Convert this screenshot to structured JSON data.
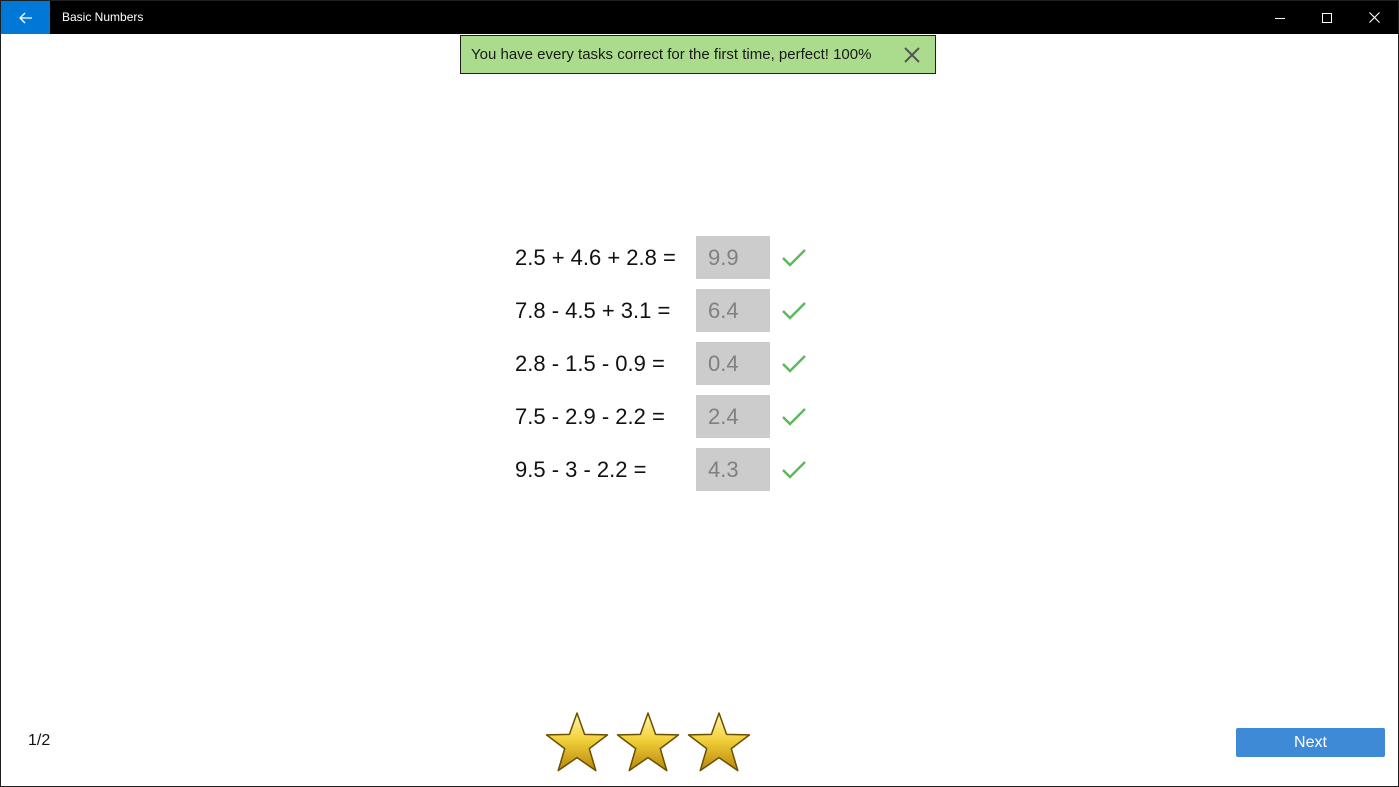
{
  "window": {
    "title": "Basic Numbers",
    "accent_color": "#0078d7",
    "icons": [
      "back-arrow-icon",
      "minimize-icon",
      "maximize-icon",
      "close-icon"
    ]
  },
  "banner": {
    "message": "You have every tasks correct for the first time, perfect! 100%",
    "background_color": "#abdc8e",
    "icon": "close-icon"
  },
  "tasks": [
    {
      "expression": "2.5 + 4.6 + 2.8 =",
      "answer": "9.9",
      "status": "correct"
    },
    {
      "expression": "7.8 - 4.5 + 3.1 =",
      "answer": "6.4",
      "status": "correct"
    },
    {
      "expression": "2.8 - 1.5 - 0.9 =",
      "answer": "0.4",
      "status": "correct"
    },
    {
      "expression": "7.5 - 2.9 - 2.2 =",
      "answer": "2.4",
      "status": "correct"
    },
    {
      "expression": "9.5 - 3 - 2.2 =",
      "answer": "4.3",
      "status": "correct"
    }
  ],
  "check_color": "#5cb85c",
  "footer": {
    "page_indicator": "1/2",
    "stars_earned": 3,
    "stars_total": 3,
    "next_label": "Next",
    "next_color": "#3e8ad6"
  }
}
